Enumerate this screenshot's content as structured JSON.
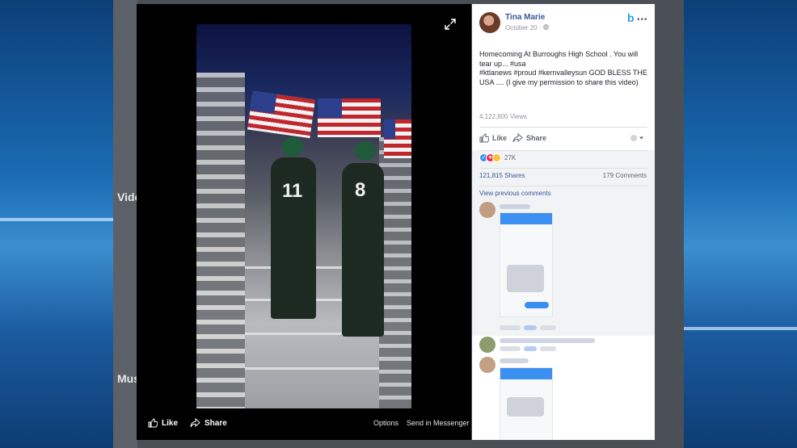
{
  "background": {
    "left_texts": [
      "Vide",
      "Mus"
    ]
  },
  "video": {
    "jersey_numbers": [
      "11",
      "8"
    ],
    "actions": {
      "like": "Like",
      "share": "Share"
    },
    "links": {
      "options": "Options",
      "send": "Send in Messenger"
    }
  },
  "post": {
    "author": "Tina Marie",
    "date": "October 20 · ",
    "text_line1": "Homecoming At Burroughs High School . You will tear up... #usa",
    "text_line2": "#ktlanews #proud #kernvalleysun GOD BLESS THE USA .... (I give my permission to share this video)",
    "views": "4,122,800 Views",
    "actions": {
      "like": "Like",
      "share": "Share"
    },
    "reactions_count": "27K",
    "shares": "121,815 Shares",
    "comments": "179 Comments",
    "view_previous": "View previous comments"
  },
  "colors": {
    "facebook_blue": "#385898",
    "messenger_blue": "#3b8ff0",
    "text_dark": "#1d2129",
    "text_gray": "#90949c"
  }
}
